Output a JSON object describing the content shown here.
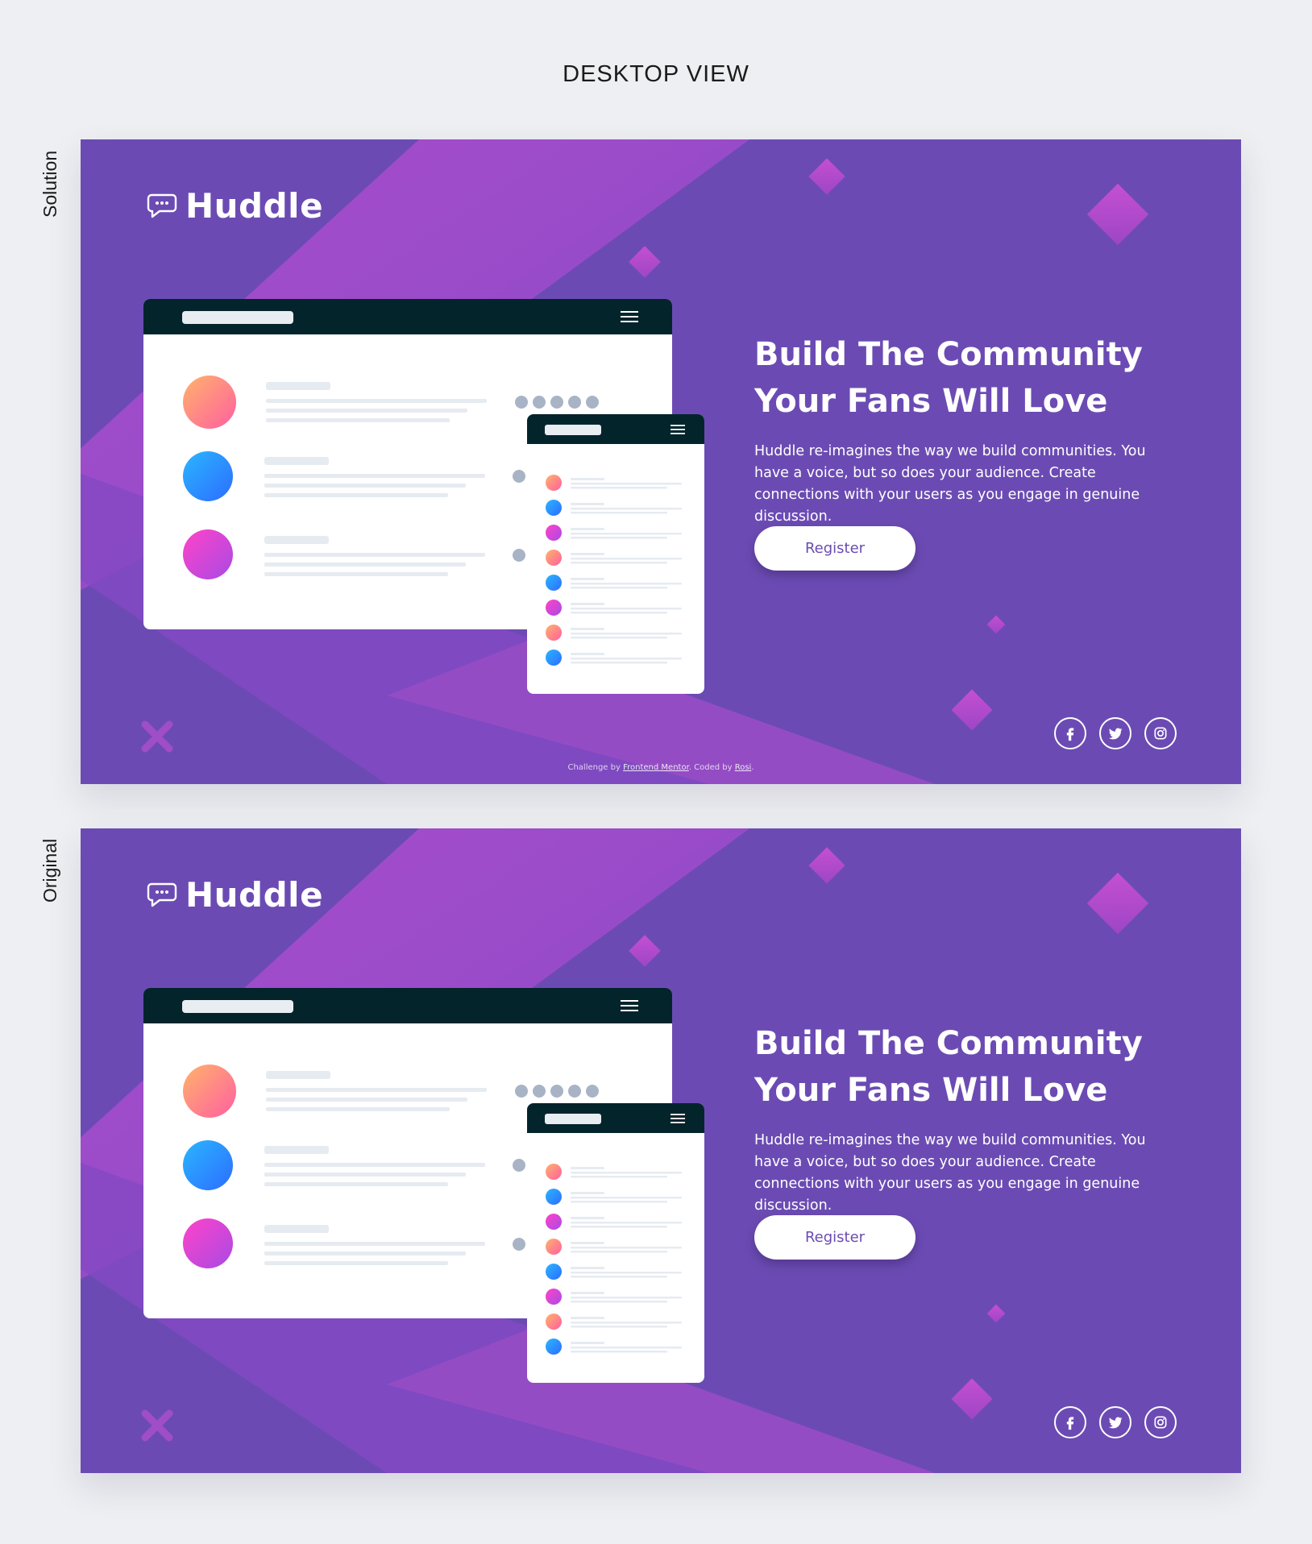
{
  "page": {
    "title": "DESKTOP VIEW"
  },
  "panels": [
    {
      "label": "Solution",
      "brand": "Huddle",
      "hero": {
        "line1": "Build The Community",
        "line2": "Your Fans Will Love",
        "description": "Huddle re-imagines the way we build communities. You have a voice, but so does your audience. Create connections with your users as you engage in genuine discussion."
      },
      "register_label": "Register",
      "social_icons": [
        "facebook-icon",
        "twitter-icon",
        "instagram-icon"
      ],
      "attribution": {
        "prefix": "Challenge by",
        "link1": "Frontend Mentor",
        "middle": ". Coded by",
        "link2": "Rosi",
        "suffix": "."
      }
    },
    {
      "label": "Original",
      "brand": "Huddle",
      "hero": {
        "line1": "Build The Community",
        "line2": "Your Fans Will Love",
        "description": "Huddle re-imagines the way we build communities. You have a voice, but so does your audience. Create connections with your users as you engage in genuine discussion."
      },
      "register_label": "Register",
      "social_icons": [
        "facebook-icon",
        "twitter-icon",
        "instagram-icon"
      ]
    }
  ],
  "colors": {
    "page_bg": "#eeeff2",
    "panel_bg": "#6b4bb3",
    "accent": "#a14ec6",
    "mock_bar": "#04242c",
    "text_dark": "#1b1b1b"
  }
}
